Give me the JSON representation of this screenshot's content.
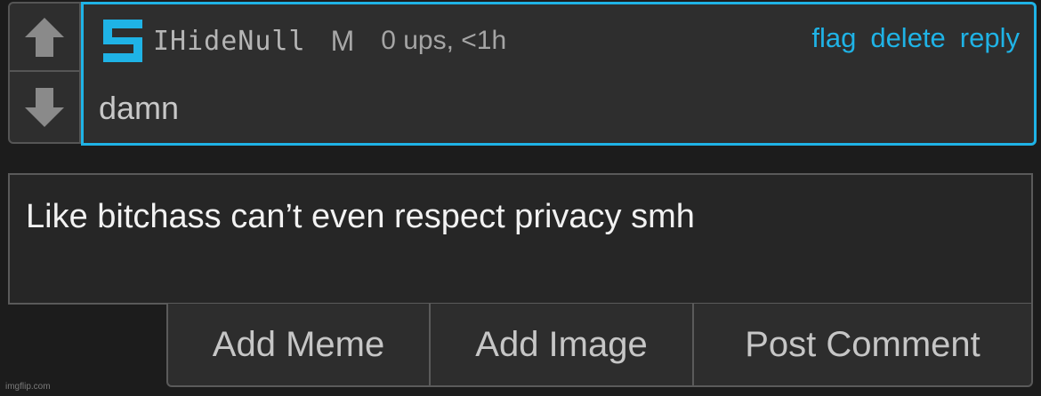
{
  "comment": {
    "username": "IHideNull",
    "badge": "M",
    "stats": "0 ups, <1h",
    "actions": {
      "flag": "flag",
      "delete": "delete",
      "reply": "reply"
    },
    "text": "damn"
  },
  "composer": {
    "text": "Like bitchass can’t even respect privacy smh",
    "buttons": {
      "add_meme": "Add Meme",
      "add_image": "Add Image",
      "post_comment": "Post Comment"
    }
  },
  "watermark": "imgflip.com",
  "colors": {
    "accent": "#1fb3e6",
    "background": "#1c1c1c",
    "card": "#2e2e2e",
    "border": "#555555"
  }
}
